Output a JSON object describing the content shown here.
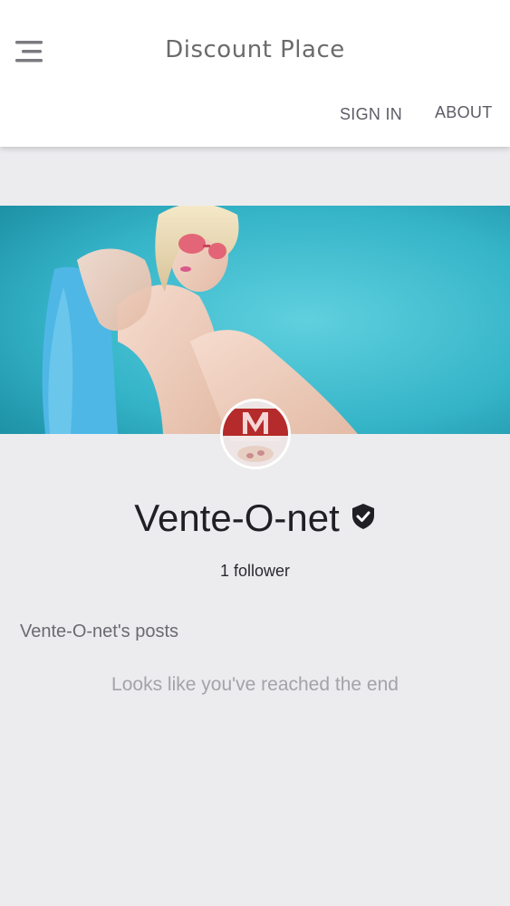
{
  "header": {
    "brand": "Discount Place",
    "nav": {
      "sign_in": "SIGN IN",
      "about": "ABOUT"
    },
    "menu_icon": "hamburger-menu-icon"
  },
  "profile": {
    "name": "Vente-O-net",
    "verified_icon": "verified-shield-icon",
    "followers": "1 follower",
    "avatar_text": "Vente-O-net"
  },
  "posts": {
    "heading": "Vente-O-net's posts",
    "empty_message": "Looks like you've reached the end"
  },
  "colors": {
    "cover_bg": "#3bb7c9",
    "avatar_accent": "#b52a2a",
    "page_bg": "#ececef"
  }
}
